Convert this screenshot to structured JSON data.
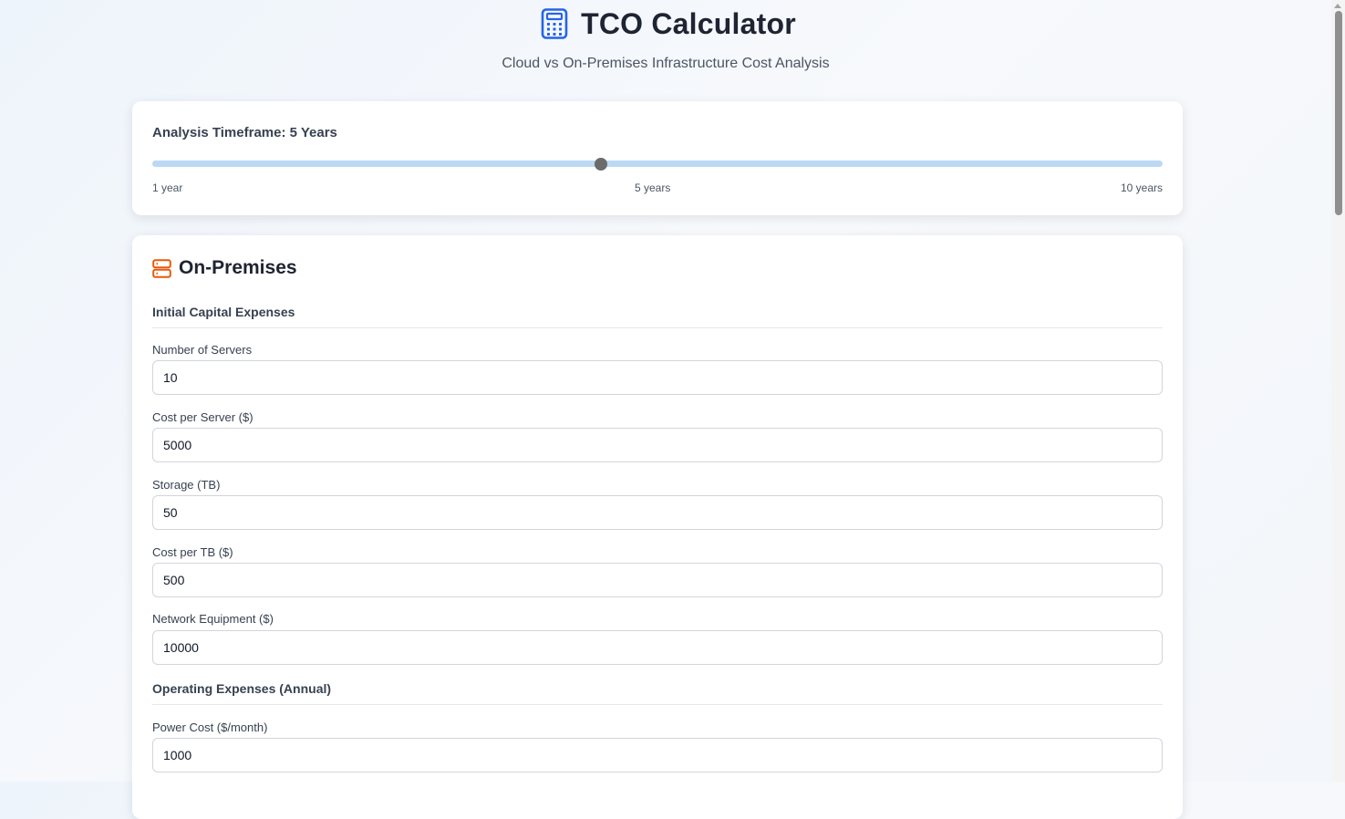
{
  "header": {
    "title": "TCO Calculator",
    "subtitle": "Cloud vs On-Premises Infrastructure Cost Analysis",
    "icon": "calculator-icon",
    "accent_color": "#2563eb"
  },
  "timeframe": {
    "label": "Analysis Timeframe: 5 Years",
    "value_years": 5,
    "min_years": 1,
    "max_years": 10,
    "tick_labels": [
      "1 year",
      "5 years",
      "10 years"
    ]
  },
  "on_premises": {
    "title": "On-Premises",
    "icon": "server-icon",
    "icon_color": "#ea580c",
    "capital_heading": "Initial Capital Expenses",
    "operating_heading": "Operating Expenses (Annual)",
    "fields": [
      {
        "label": "Number of Servers",
        "value": "10"
      },
      {
        "label": "Cost per Server ($)",
        "value": "5000"
      },
      {
        "label": "Storage (TB)",
        "value": "50"
      },
      {
        "label": "Cost per TB ($)",
        "value": "500"
      },
      {
        "label": "Network Equipment ($)",
        "value": "10000"
      },
      {
        "label": "Power Cost ($/month)",
        "value": "1000"
      }
    ]
  }
}
